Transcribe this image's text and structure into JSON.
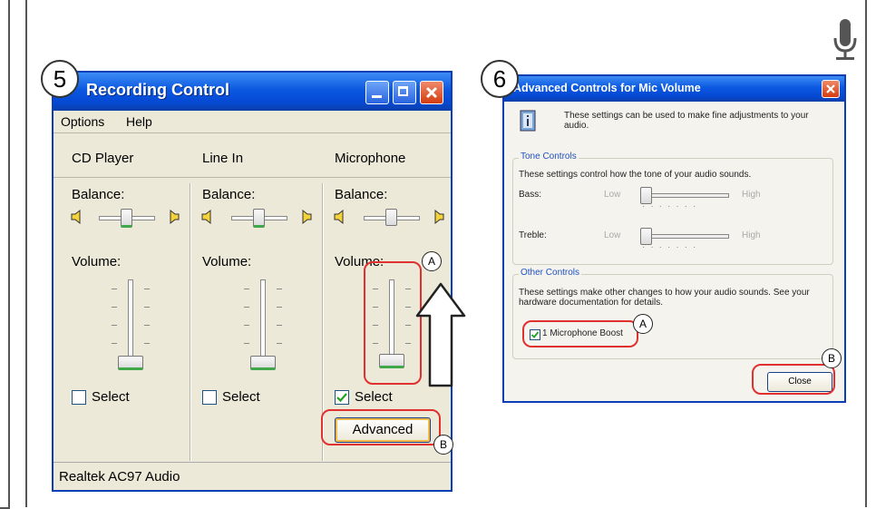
{
  "step5": {
    "number": "5",
    "title": "Recording Control",
    "menu": [
      "Options",
      "Help"
    ],
    "columns": [
      {
        "name": "CD Player",
        "balance_label": "Balance:",
        "volume_label": "Volume:",
        "select_label": "Select",
        "selected": false
      },
      {
        "name": "Line In",
        "balance_label": "Balance:",
        "volume_label": "Volume:",
        "select_label": "Select",
        "selected": false
      },
      {
        "name": "Microphone",
        "balance_label": "Balance:",
        "volume_label": "Volume:",
        "select_label": "Select",
        "selected": true
      }
    ],
    "advanced_label": "Advanced",
    "status": "Realtek AC97 Audio",
    "callout_a": "A",
    "callout_b": "B"
  },
  "step6": {
    "number": "6",
    "title": "Advanced Controls for Mic Volume",
    "intro": "These settings can be used to make fine adjustments to your audio.",
    "tone": {
      "title": "Tone Controls",
      "desc": "These settings control how the tone of your audio sounds.",
      "bass_label": "Bass:",
      "treble_label": "Treble:",
      "low": "Low",
      "high": "High"
    },
    "other": {
      "title": "Other Controls",
      "desc": "These settings make other changes to how your audio sounds.  See your hardware documentation for details.",
      "boost_label": "1  Microphone Boost",
      "boost_checked": true
    },
    "close_label": "Close",
    "callout_a": "A",
    "callout_b": "B"
  },
  "icons": [
    "mic-icon",
    "speaker-left-icon",
    "speaker-right-icon",
    "info-book-icon",
    "up-arrow-icon"
  ],
  "colors": {
    "highlight": "#e03030",
    "xp_blue": "#0b58e0",
    "xp_face": "#ece9d8"
  }
}
